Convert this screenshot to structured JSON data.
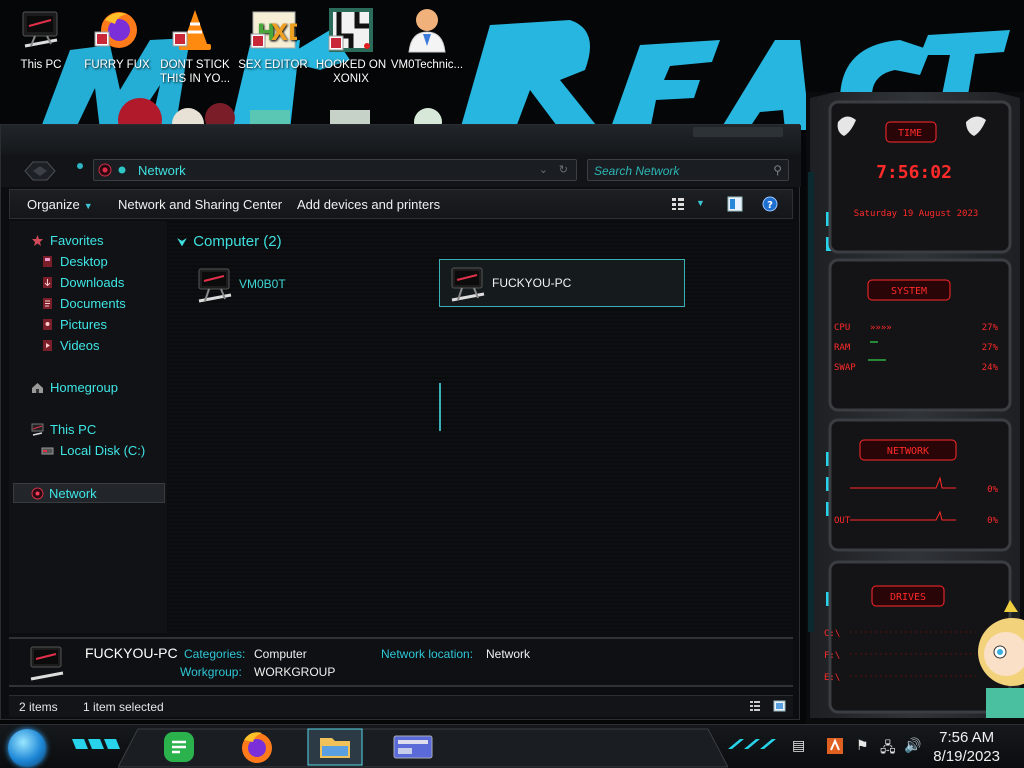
{
  "desktop": {
    "icons": [
      {
        "label": "This PC",
        "icon": "computer-icon"
      },
      {
        "label": "FURRY FUX",
        "icon": "firefox-shortcut-icon"
      },
      {
        "label": "DONT STICK THIS IN YO...",
        "icon": "vlc-shortcut-icon"
      },
      {
        "label": "SEX EDITOR",
        "icon": "xd-editor-shortcut-icon"
      },
      {
        "label": "HOOKED ON XONIX",
        "icon": "xonix-game-shortcut-icon"
      },
      {
        "label": "VM0Technic...",
        "icon": "doctor-avatar-icon"
      }
    ]
  },
  "explorer": {
    "address": "Network",
    "search_placeholder": "Search Network",
    "commands": {
      "organize": "Organize",
      "network_sharing": "Network and Sharing Center",
      "add_devices": "Add devices and printers"
    },
    "nav": {
      "favorites": "Favorites",
      "desktop": "Desktop",
      "downloads": "Downloads",
      "documents": "Documents",
      "pictures": "Pictures",
      "videos": "Videos",
      "homegroup": "Homegroup",
      "this_pc": "This PC",
      "local_disk": "Local Disk (C:)",
      "network": "Network"
    },
    "group_header": "Computer (2)",
    "items": [
      {
        "name": "VM0B0T",
        "selected": false
      },
      {
        "name": "FUCKYOU-PC",
        "selected": true
      }
    ],
    "details": {
      "name": "FUCKYOU-PC",
      "categories_label": "Categories:",
      "categories_value": "Computer",
      "workgroup_label": "Workgroup:",
      "workgroup_value": "WORKGROUP",
      "network_location_label": "Network location:",
      "network_location_value": "Network"
    },
    "status": {
      "count": "2 items",
      "selected": "1 item selected"
    }
  },
  "gadgets": {
    "time_title": "TIME",
    "time_value": "7:56:02",
    "date_value": "Saturday 19 August 2023",
    "system_title": "SYSTEM",
    "cpu_label": "CPU",
    "cpu_value": "27%",
    "ram_label": "RAM",
    "ram_value": "27%",
    "swap_label": "SWAP",
    "swap_value": "24%",
    "network_title": "NETWORK",
    "net_in_value": "0%",
    "net_out_label": "OUT",
    "net_out_value": "0%",
    "drives_title": "DRIVES",
    "drives": [
      "C:\\",
      "F:\\",
      "E:\\"
    ]
  },
  "taskbar": {
    "apps": [
      "feedly-icon",
      "firefox-icon",
      "file-explorer-icon",
      "control-panel-icon"
    ],
    "clock_time": "7:56 AM",
    "clock_date": "8/19/2023"
  },
  "colors": {
    "accent_cyan": "#3fe0e0",
    "gadget_red": "#ff2a2a",
    "wallpaper_blue": "#26b6e0"
  }
}
